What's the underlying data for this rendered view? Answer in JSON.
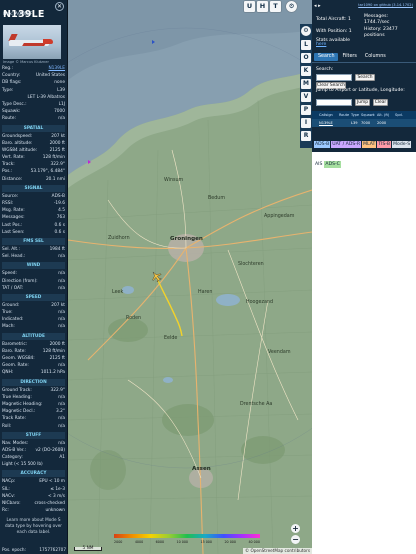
{
  "aircraft": {
    "callsign": "N139LE",
    "hex_line": "Hex: A0909F",
    "photo_credit": "Image © Marcus Klutzner",
    "info_rows": [
      {
        "k": "Reg.:",
        "v": "N139LE",
        "link": true
      },
      {
        "k": "Country:",
        "v": "United States",
        "link": false
      },
      {
        "k": "DB flags:",
        "v": "none",
        "link": false
      },
      {
        "k": "Type:",
        "v": "L39",
        "link": false
      },
      {
        "k": "",
        "v": "LET L-39 Albatros",
        "link": false
      },
      {
        "k": "Type Desc.:",
        "v": "L1J",
        "link": false
      },
      {
        "k": "Squawk:",
        "v": "7000",
        "link": false
      },
      {
        "k": "Route:",
        "v": "n/a",
        "link": false
      }
    ],
    "sections": [
      {
        "title": "SPATIAL",
        "rows": [
          {
            "k": "Groundspeed:",
            "v": "207 kt"
          },
          {
            "k": "Baro. altitude:",
            "v": "2000 ft"
          },
          {
            "k": "WGS84 altitude:",
            "v": "2125 ft"
          },
          {
            "k": "Vert. Rate:",
            "v": "128 ft/min"
          },
          {
            "k": "Track:",
            "v": "322.9°"
          },
          {
            "k": "Pos.:",
            "v": "53.179°, 6.484°"
          },
          {
            "k": "Distance:",
            "v": "20.1 nmi"
          }
        ]
      },
      {
        "title": "SIGNAL",
        "rows": [
          {
            "k": "Source:",
            "v": "ADS-B"
          },
          {
            "k": "RSSI:",
            "v": "-19.6"
          },
          {
            "k": "Msg. Rate:",
            "v": "4.5"
          },
          {
            "k": "Messages:",
            "v": "763"
          },
          {
            "k": "Last Pos.:",
            "v": "0.6 s"
          },
          {
            "k": "Last Seen:",
            "v": "0.6 s"
          }
        ]
      },
      {
        "title": "FMS SEL",
        "rows": [
          {
            "k": "Sel. Alt.:",
            "v": "1984 ft"
          },
          {
            "k": "Sel. Head.:",
            "v": "n/a"
          }
        ]
      },
      {
        "title": "WIND",
        "rows": [
          {
            "k": "Speed:",
            "v": "n/a"
          },
          {
            "k": "Direction (from):",
            "v": "n/a"
          },
          {
            "k": "TAT / OAT:",
            "v": "n/a"
          }
        ]
      },
      {
        "title": "SPEED",
        "rows": [
          {
            "k": "Ground:",
            "v": "207 kt"
          },
          {
            "k": "True:",
            "v": "n/a"
          },
          {
            "k": "Indicated:",
            "v": "n/a"
          },
          {
            "k": "Mach:",
            "v": "n/a"
          }
        ]
      },
      {
        "title": "ALTITUDE",
        "rows": [
          {
            "k": "Barometric:",
            "v": "2000 ft"
          },
          {
            "k": "Baro. Rate:",
            "v": "128 ft/min"
          },
          {
            "k": "Geom. WGS84:",
            "v": "2125 ft"
          },
          {
            "k": "Geom. Rate:",
            "v": "n/a"
          },
          {
            "k": "QNH:",
            "v": "1011.2 hPa"
          }
        ]
      },
      {
        "title": "DIRECTION",
        "rows": [
          {
            "k": "Ground Track:",
            "v": "322.9°"
          },
          {
            "k": "True Heading:",
            "v": "n/a"
          },
          {
            "k": "Magnetic Heading:",
            "v": "n/a"
          },
          {
            "k": "Magnetic Decl.:",
            "v": "3.2°"
          },
          {
            "k": "Track Rate:",
            "v": "n/a"
          },
          {
            "k": "Roll:",
            "v": "n/a"
          }
        ]
      },
      {
        "title": "STUFF",
        "rows": [
          {
            "k": "Nav. Modes:",
            "v": "n/a"
          },
          {
            "k": "ADS-B Ver.:",
            "v": "v2 (DO-260B)"
          },
          {
            "k": "Category:",
            "v": "A1"
          },
          {
            "k": "Light (< 15 500 lb)",
            "v": ""
          }
        ]
      },
      {
        "title": "ACCURACY",
        "rows": [
          {
            "k": "NACp:",
            "v": "EPU < 10 m"
          },
          {
            "k": "SIL:",
            "v": "≤ 1e-3"
          },
          {
            "k": "NACv:",
            "v": "< 3 m/s"
          },
          {
            "k": "NICbaro:",
            "v": "cross-checked"
          },
          {
            "k": "Rc:",
            "v": "unknown"
          }
        ]
      }
    ],
    "footnote": "Learn more about Mode S data type by hovering over each data label.",
    "footer_label": "Pos. epoch:",
    "footer_value": "1757762707"
  },
  "map": {
    "top_buttons": [
      "U",
      "H",
      "T"
    ],
    "strip_buttons": [
      "L",
      "O",
      "K",
      "M",
      "V",
      "P",
      "I",
      "R"
    ],
    "places": [
      {
        "name": "Groningen",
        "city": true
      },
      {
        "name": "Assen",
        "city": true
      },
      {
        "name": "Winsum",
        "city": false
      },
      {
        "name": "Bedum",
        "city": false
      },
      {
        "name": "Leek",
        "city": false
      },
      {
        "name": "Roden",
        "city": false
      },
      {
        "name": "Zuidhorn",
        "city": false
      },
      {
        "name": "Haren",
        "city": false
      },
      {
        "name": "Eelde",
        "city": false
      },
      {
        "name": "Slochteren",
        "city": false
      },
      {
        "name": "Hoogezand",
        "city": false
      },
      {
        "name": "Veendam",
        "city": false
      },
      {
        "name": "Appingedam",
        "city": false
      },
      {
        "name": "Drentsche Aa",
        "city": false
      }
    ],
    "scale_label": "5 NM",
    "legend_labels": [
      "2000",
      "4000",
      "6000",
      "10 000",
      "15 000",
      "20 000",
      "40 000"
    ],
    "attribution": "© OpenStreetMap contributors",
    "zoom_in": "+",
    "zoom_out": "−"
  },
  "right": {
    "arrows": "◂ ▸",
    "version": "tar1090 on github (3.14.1702)",
    "total_label": "Total Aircraft: 1",
    "messages_label": "Messages:",
    "messages_value": "1744.7/sec",
    "position_label": "With Position: 1",
    "history_label": "History: 23477",
    "history_value": "positions",
    "stats_label": "Stats available",
    "more_link": "here",
    "tabs": [
      "Search",
      "Filters",
      "Columns"
    ],
    "search_label": "Search:",
    "search_button": "Search",
    "clear_search_button": "Clear Search",
    "jump_label": "Jump to Airport or Latitude, Longitude:",
    "jump_button": "Jump",
    "clear_button": "Clear",
    "table_headers": [
      "",
      "Callsign",
      "Route",
      "Type",
      "Squawk",
      "Alt. (ft)",
      "Spd."
    ],
    "table_row": [
      "",
      "N139LE",
      "",
      "L39",
      "7000",
      "2000",
      ""
    ],
    "sources": [
      {
        "label": "ADS-B",
        "color": "#9bc9ff"
      },
      {
        "label": "UAT / ADS-R",
        "color": "#c9a7ff"
      },
      {
        "label": "MLAT",
        "color": "#ffc280"
      },
      {
        "label": "TIS-B",
        "color": "#ff9aa8"
      },
      {
        "label": "Mode-S",
        "color": "#d9e2ec"
      },
      {
        "label": "AIS",
        "color": "#ffffff"
      },
      {
        "label": "ADS-C",
        "color": "#a6dfa0"
      }
    ]
  },
  "colors": {
    "panel": "#13283b",
    "section": "#1d3a52",
    "accent": "#2d75b3",
    "track": "#f2d22b",
    "plane": "#f5c542"
  }
}
